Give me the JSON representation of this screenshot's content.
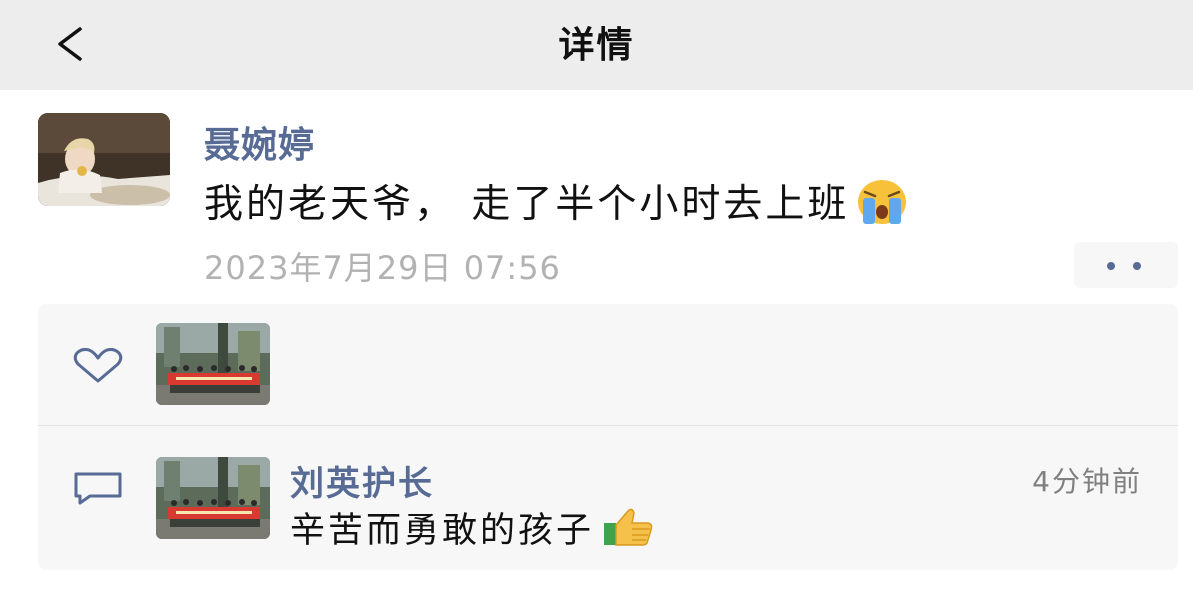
{
  "header": {
    "title": "详情",
    "back_icon": "chevron-left-icon",
    "background": "#ededed"
  },
  "post": {
    "author": "聂婉婷",
    "text": "我的老天爷， 走了半个小时去上班",
    "emoji": "loudly-crying-face",
    "timestamp": "2023年7月29日 07:56",
    "more_icon": "two-dots-icon"
  },
  "likes": {
    "icon": "heart-outline-icon",
    "avatars": [
      "group-photo-avatar"
    ]
  },
  "comments": [
    {
      "author": "刘英护长",
      "time": "4分钟前",
      "text": "辛苦而勇敢的孩子",
      "emoji": "thumbs-up"
    }
  ],
  "colors": {
    "name_link": "#576b95",
    "text": "#111111",
    "timestamp": "#b2b2b2",
    "panel": "#f7f7f7"
  }
}
